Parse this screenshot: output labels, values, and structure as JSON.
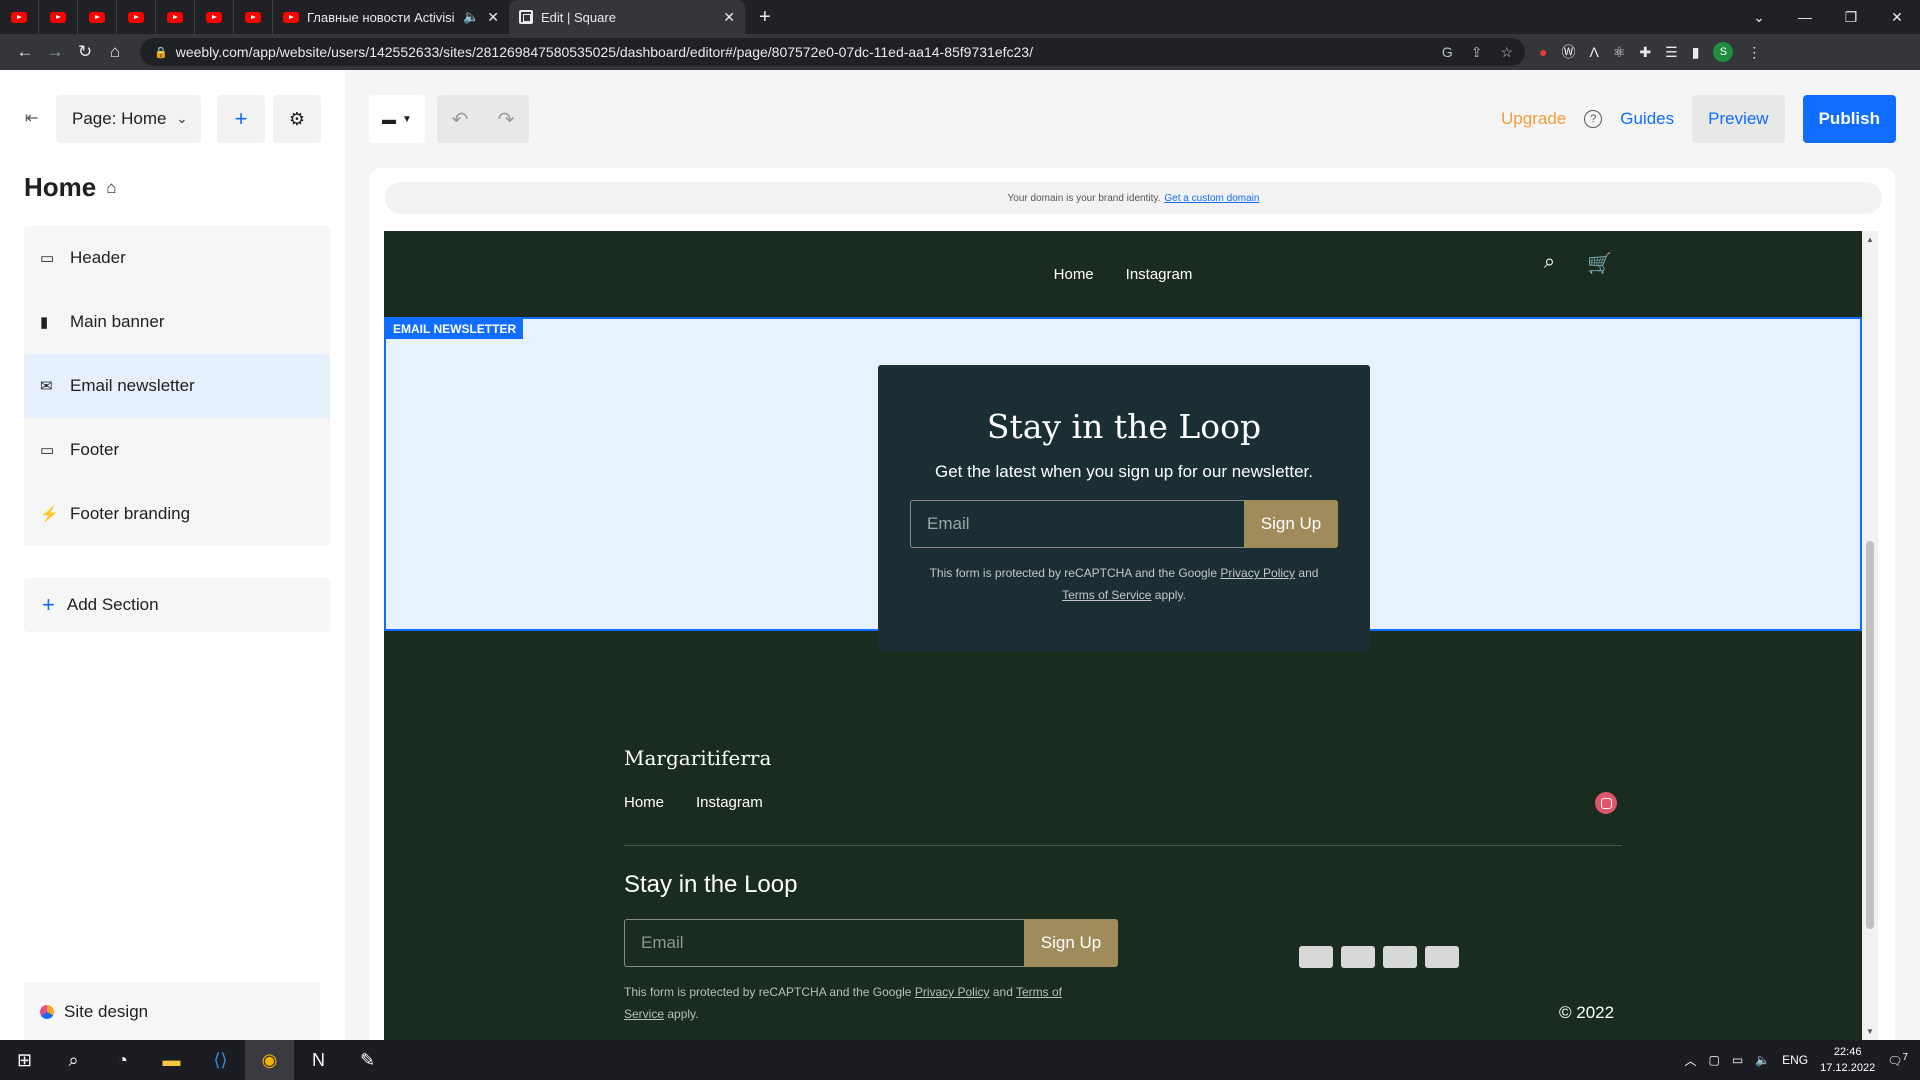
{
  "browser": {
    "pinned_tab_count": 7,
    "tabs": [
      {
        "title": "Главные новости Activision",
        "icon": "youtube-icon"
      },
      {
        "title": "Edit | Square",
        "icon": "square-icon"
      }
    ],
    "url": "weebly.com/app/website/users/142552633/sites/281269847580535025/dashboard/editor#/page/807572e0-07dc-11ed-aa14-85f9731efc23/"
  },
  "editor": {
    "page_selector": "Page: Home",
    "page_title": "Home",
    "sections": [
      {
        "label": "Header",
        "icon": "header-icon",
        "selected": false
      },
      {
        "label": "Main banner",
        "icon": "bookmark-icon",
        "selected": false
      },
      {
        "label": "Email newsletter",
        "icon": "mail-icon",
        "selected": true
      },
      {
        "label": "Footer",
        "icon": "footer-icon",
        "selected": false
      },
      {
        "label": "Footer branding",
        "icon": "bolt-icon",
        "selected": false
      }
    ],
    "add_section": "Add Section",
    "site_design": "Site design",
    "upgrade": "Upgrade",
    "guides": "Guides",
    "preview": "Preview",
    "publish": "Publish",
    "domain_notice": "Your domain is your brand identity.",
    "domain_link": "Get a custom domain"
  },
  "site": {
    "nav": [
      "Home",
      "Instagram"
    ],
    "section_tag": "EMAIL NEWSLETTER",
    "newsletter": {
      "title": "Stay in the Loop",
      "subtitle": "Get the latest when you sign up for our newsletter.",
      "email_placeholder": "Email",
      "button": "Sign Up",
      "legal_prefix": "This form is protected by reCAPTCHA and the Google",
      "privacy": "Privacy Policy",
      "and": "and",
      "terms": "Terms of Service",
      "apply": "apply."
    },
    "footer": {
      "brand": "Margaritiferra",
      "nav": [
        "Home",
        "Instagram"
      ],
      "title": "Stay in the Loop",
      "email_placeholder": "Email",
      "button": "Sign Up",
      "legal_prefix": "This form is protected by reCAPTCHA and the Google",
      "privacy": "Privacy Policy",
      "and": "and",
      "terms": "Terms of Service",
      "apply": "apply.",
      "copyright": "© 2022"
    }
  },
  "taskbar": {
    "lang": "ENG",
    "time": "22:46",
    "date": "17.12.2022",
    "notifications": "7"
  },
  "colors": {
    "accent": "#116dff",
    "site_bg": "#1a2b1f",
    "card_bg": "#1b2e34",
    "button_gold": "#a08c5b",
    "upgrade": "#f39c3c"
  }
}
